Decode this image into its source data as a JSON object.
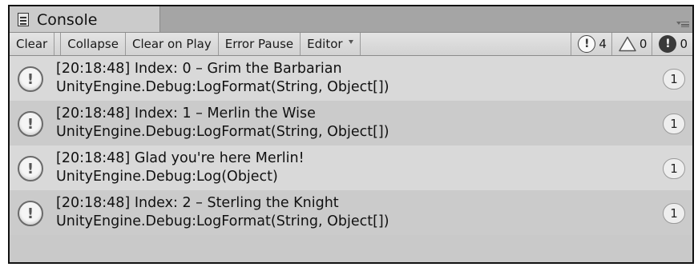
{
  "window": {
    "tab_title": "Console",
    "tab_icon": "console-icon"
  },
  "toolbar": {
    "clear": "Clear",
    "collapse": "Collapse",
    "clear_on_play": "Clear on Play",
    "error_pause": "Error Pause",
    "editor": "Editor",
    "counts": {
      "info": "4",
      "warning": "0",
      "error": "0"
    }
  },
  "logs": [
    {
      "message": "[20:18:48] Index: 0 – Grim the Barbarian",
      "trace": "UnityEngine.Debug:LogFormat(String, Object[])",
      "count": "1",
      "icon": "info-icon"
    },
    {
      "message": "[20:18:48] Index: 1 – Merlin the Wise",
      "trace": "UnityEngine.Debug:LogFormat(String, Object[])",
      "count": "1",
      "icon": "info-icon"
    },
    {
      "message": "[20:18:48] Glad you're here Merlin!",
      "trace": "UnityEngine.Debug:Log(Object)",
      "count": "1",
      "icon": "info-icon"
    },
    {
      "message": "[20:18:48] Index: 2 – Sterling the Knight",
      "trace": "UnityEngine.Debug:LogFormat(String, Object[])",
      "count": "1",
      "icon": "info-icon"
    }
  ],
  "colors": {
    "tab_active": "#cbcbcb",
    "tab_strip": "#a5a5a5",
    "row_light": "#d9d9d9",
    "row_dark": "#cbcbcb"
  }
}
